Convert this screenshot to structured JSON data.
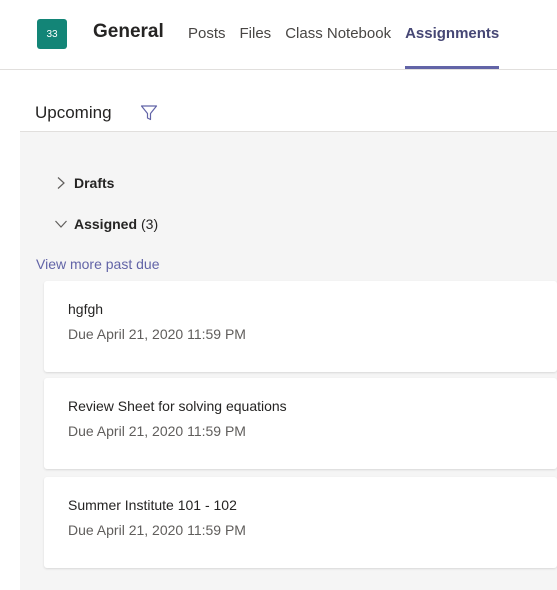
{
  "header": {
    "team_avatar_text": "33",
    "channel_title": "General",
    "tabs": [
      {
        "label": "Posts"
      },
      {
        "label": "Files"
      },
      {
        "label": "Class Notebook"
      },
      {
        "label": "Assignments"
      }
    ],
    "active_tab": "Assignments"
  },
  "filter_bar": {
    "label": "Upcoming",
    "icon": "filter-icon"
  },
  "sections": {
    "drafts": {
      "label": "Drafts",
      "icon": "chevron-right-icon"
    },
    "assigned": {
      "label": "Assigned",
      "count": "(3)",
      "icon": "chevron-down-icon"
    }
  },
  "view_more_link": "View more past due",
  "assignments": [
    {
      "title": "hgfgh",
      "due": "Due April 21, 2020 11:59 PM"
    },
    {
      "title": "Review Sheet for solving equations",
      "due": "Due April 21, 2020 11:59 PM"
    },
    {
      "title": "Summer Institute 101 - 102",
      "due": "Due April 21, 2020 11:59 PM"
    }
  ],
  "colors": {
    "accent": "#6264a7",
    "team_avatar": "#138577",
    "content_background": "#f5f5f5"
  }
}
